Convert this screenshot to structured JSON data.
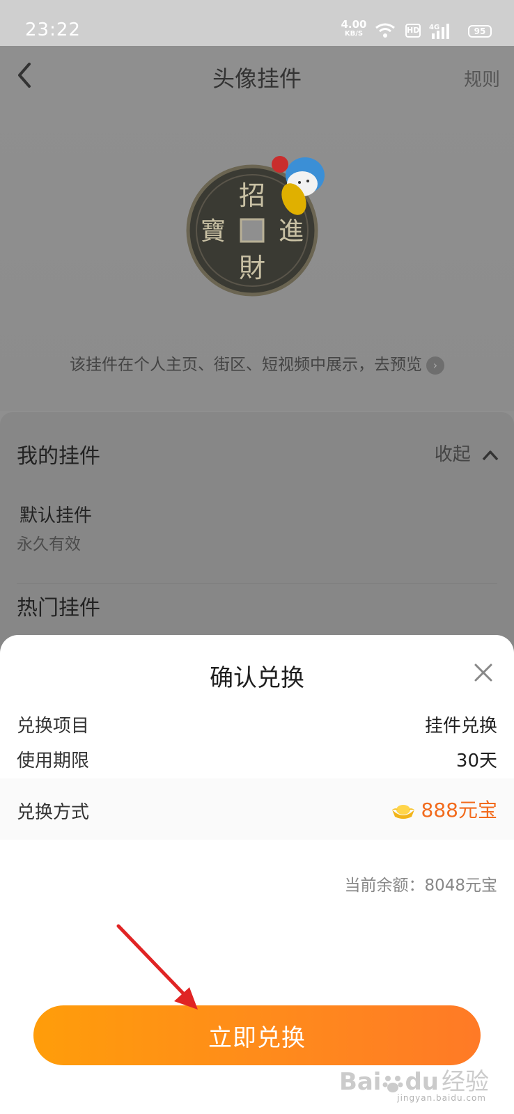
{
  "status_bar": {
    "time": "23:22",
    "net_speed": "4.00",
    "net_unit": "KB/S",
    "hd": "HD",
    "network": "4G",
    "battery": "95"
  },
  "header": {
    "title": "头像挂件",
    "rules": "规则"
  },
  "preview": {
    "coin_chars": [
      "招",
      "寶",
      "進",
      "財"
    ],
    "hint": "该挂件在个人主页、街区、短视频中展示，去预览"
  },
  "my_pendants": {
    "title": "我的挂件",
    "collapse": "收起",
    "default_name": "默认挂件",
    "default_validity": "永久有效"
  },
  "hot_pendants": {
    "title": "热门挂件"
  },
  "sheet": {
    "title": "确认兑换",
    "rows": [
      {
        "label": "兑换项目",
        "value": "挂件兑换"
      },
      {
        "label": "使用期限",
        "value": "30天"
      },
      {
        "label": "兑换方式",
        "value": "888元宝"
      }
    ],
    "balance": "当前余额：8048元宝",
    "confirm_button": "立即兑换"
  },
  "watermark": {
    "brand": "Bai",
    "brand_suffix": "du",
    "brand_cn": "经验",
    "url": "jingyan.baidu.com"
  },
  "colors": {
    "accent": "#ff8a1c",
    "price": "#f26b1d",
    "dim_overlay": "#8f8f8f"
  }
}
